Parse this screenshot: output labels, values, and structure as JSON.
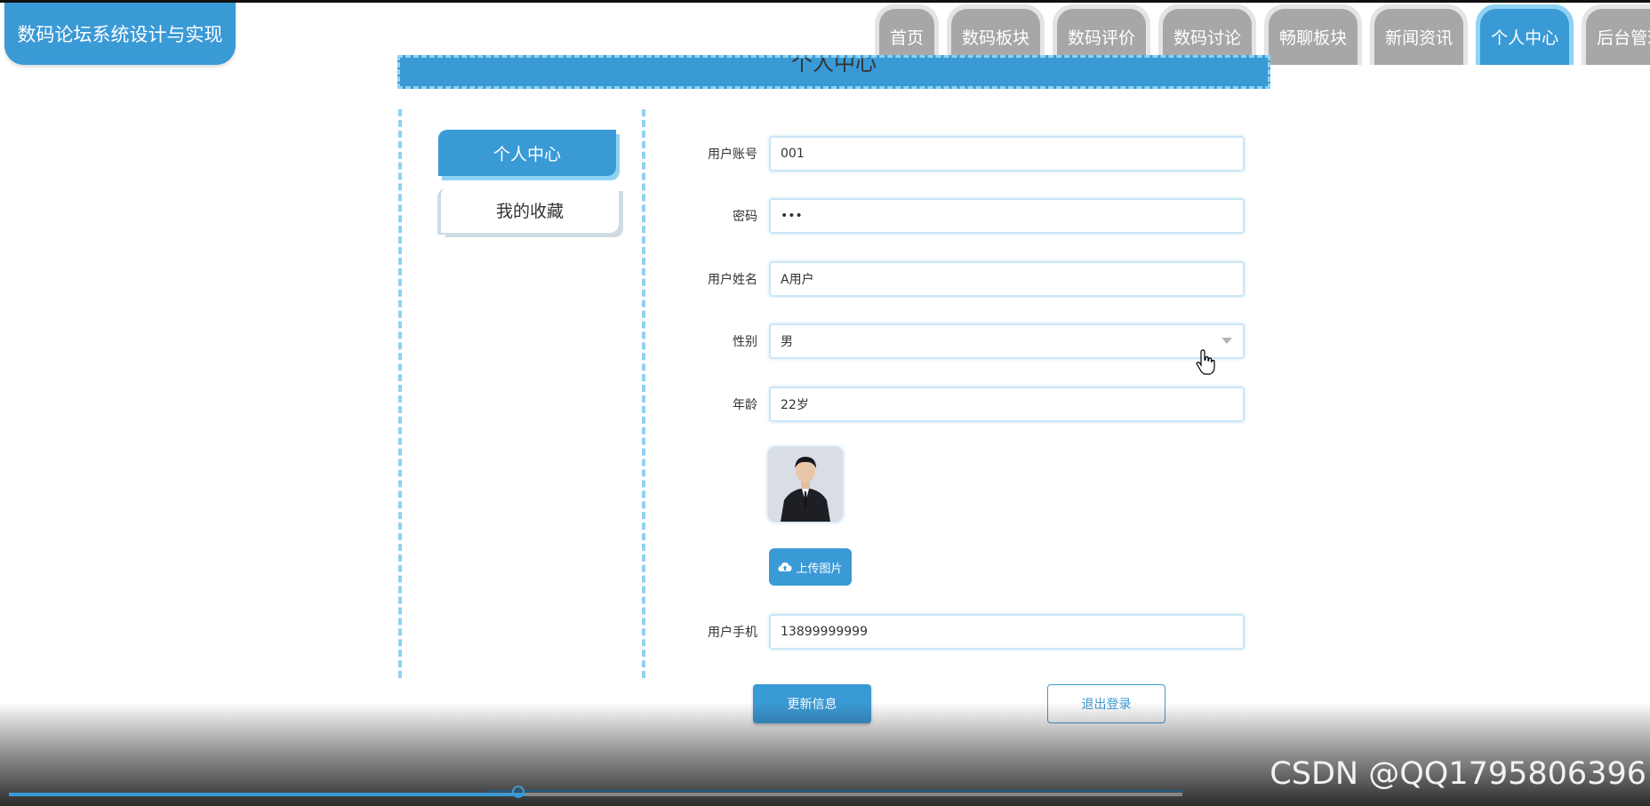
{
  "app": {
    "title": "数码论坛系统设计与实现"
  },
  "nav": {
    "items": [
      {
        "label": "首页",
        "active": false
      },
      {
        "label": "数码板块",
        "active": false
      },
      {
        "label": "数码评价",
        "active": false
      },
      {
        "label": "数码讨论",
        "active": false
      },
      {
        "label": "畅聊板块",
        "active": false
      },
      {
        "label": "新闻资讯",
        "active": false
      },
      {
        "label": "个人中心",
        "active": true
      },
      {
        "label": "后台管理",
        "active": false
      }
    ]
  },
  "page": {
    "title": "个人中心"
  },
  "sidebar": {
    "items": [
      {
        "label": "个人中心",
        "active": true
      },
      {
        "label": "我的收藏",
        "active": false
      }
    ]
  },
  "form": {
    "account": {
      "label": "用户账号",
      "value": "001"
    },
    "password": {
      "label": "密码",
      "value": "•••"
    },
    "name": {
      "label": "用户姓名",
      "value": "A用户"
    },
    "gender": {
      "label": "性别",
      "value": "男"
    },
    "age": {
      "label": "年龄",
      "value": "22岁"
    },
    "upload_button": "上传图片",
    "phone": {
      "label": "用户手机",
      "value": "13899999999"
    }
  },
  "actions": {
    "update": "更新信息",
    "logout": "退出登录"
  },
  "video": {
    "watermark": "CSDN @QQ1795806396",
    "progress": 0.44
  },
  "colors": {
    "primary": "#3a9ad6",
    "accent_light": "#8fd2f2",
    "nav_inactive": "#a7a7a7"
  }
}
